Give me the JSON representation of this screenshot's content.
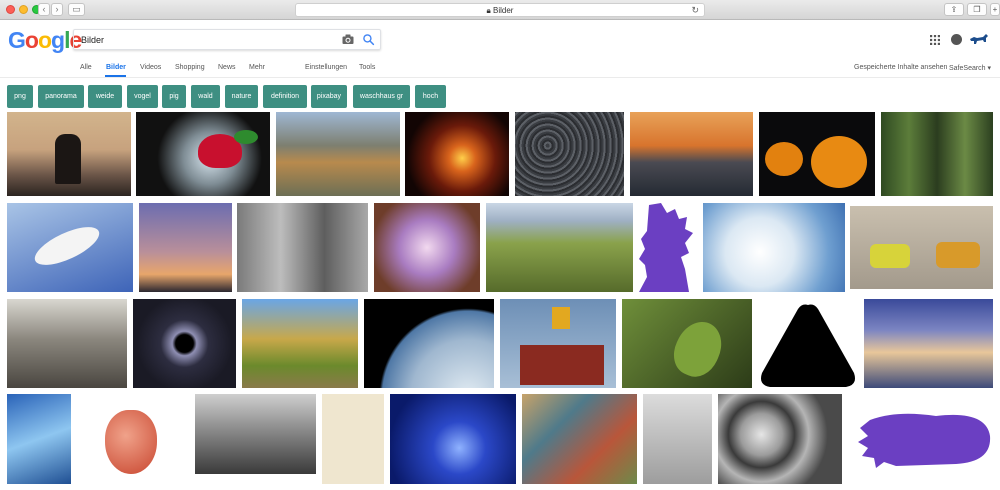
{
  "browser": {
    "address": "Bilder"
  },
  "search": {
    "query": "Bilder"
  },
  "tabs": [
    {
      "label": "Alle",
      "active": false
    },
    {
      "label": "Bilder",
      "active": true
    },
    {
      "label": "Videos",
      "active": false
    },
    {
      "label": "Shopping",
      "active": false
    },
    {
      "label": "News",
      "active": false
    },
    {
      "label": "Mehr",
      "active": false
    },
    {
      "label": "Einstellungen",
      "active": false
    },
    {
      "label": "Tools",
      "active": false
    }
  ],
  "right_links": {
    "saved": "Gespeicherte Inhalte ansehen",
    "safesearch": "SafeSearch ▾"
  },
  "chips": [
    "png",
    "panorama",
    "weide",
    "vogel",
    "pig",
    "wald",
    "nature",
    "definition",
    "pixabay",
    "waschhaus gr",
    "hoch"
  ],
  "colors": {
    "chip_bg": "#3e8f82",
    "accent": "#1a73e8"
  }
}
